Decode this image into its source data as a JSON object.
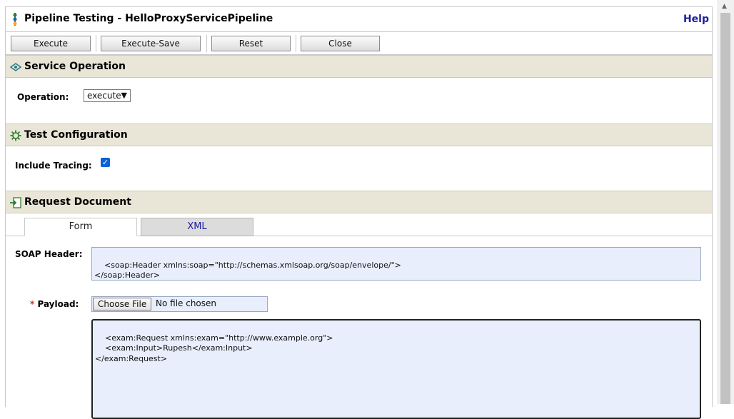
{
  "window": {
    "title": "Pipeline Testing - HelloProxyServicePipeline",
    "help_label": "Help"
  },
  "toolbar": {
    "buttons": [
      {
        "label": "Execute"
      },
      {
        "label": "Execute-Save"
      },
      {
        "label": "Reset"
      },
      {
        "label": "Close"
      }
    ]
  },
  "service_operation": {
    "title": "Service Operation",
    "operation_label": "Operation:",
    "operation_value": "execute"
  },
  "test_configuration": {
    "title": "Test Configuration",
    "include_tracing_label": "Include Tracing:",
    "include_tracing_checked": true
  },
  "request_document": {
    "title": "Request Document",
    "tabs": [
      {
        "label": "Form",
        "active": true
      },
      {
        "label": "XML",
        "active": false
      }
    ],
    "soap_header_label": "SOAP Header:",
    "soap_header_value": "<soap:Header xmlns:soap=\"http://schemas.xmlsoap.org/soap/envelope/\">\n</soap:Header>",
    "payload_required_mark": "*",
    "payload_label": "Payload:",
    "choose_file_label": "Choose File",
    "file_status": "No file chosen",
    "payload_value": "<exam:Request xmlns:exam=\"http://www.example.org\">\n    <exam:Input>Rupesh</exam:Input>\n</exam:Request>"
  },
  "colors": {
    "section_header_bg": "#e9e6d7",
    "textarea_bg": "#e8eefc",
    "help_link": "#1e1e9e",
    "checkbox_accent": "#0b62d6"
  }
}
